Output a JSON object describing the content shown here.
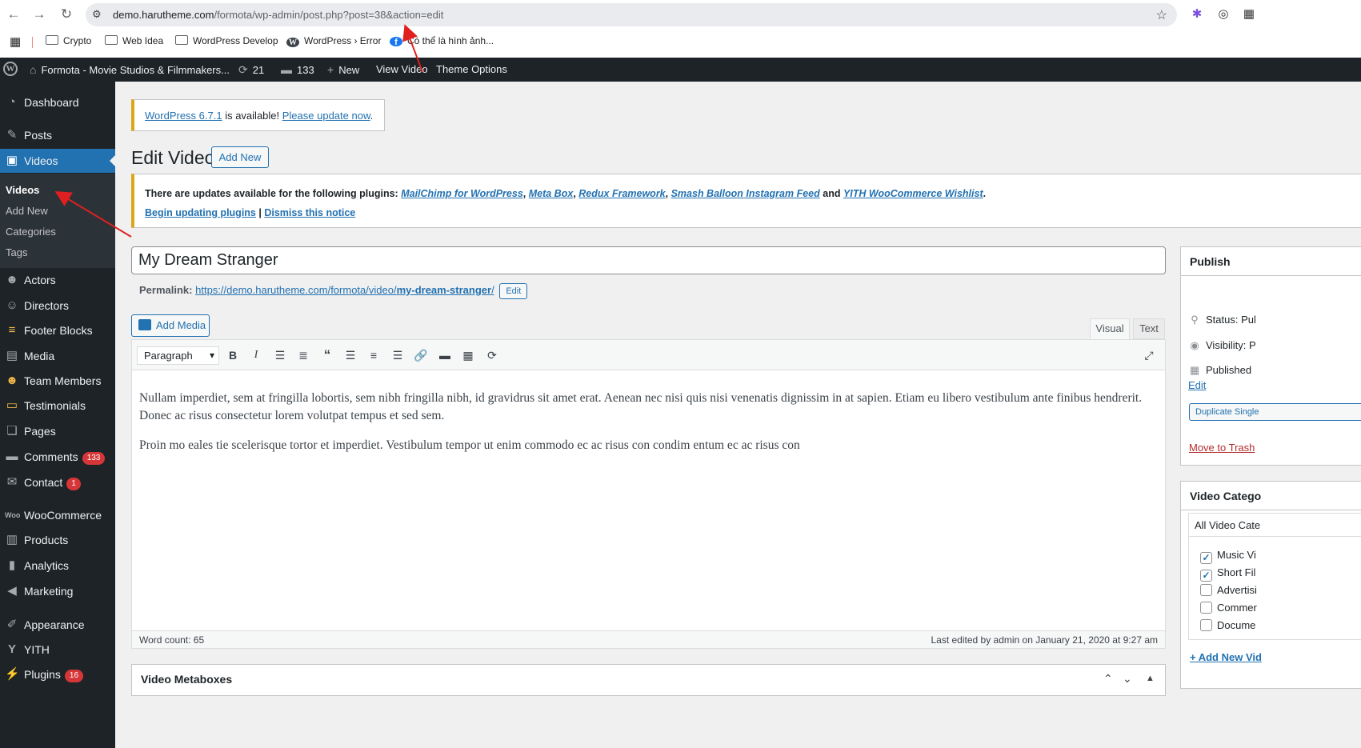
{
  "browser": {
    "url_host": "demo.harutheme.com",
    "url_path": "/formota/wp-admin/post.php?post=38&action=edit",
    "bookmarks": [
      {
        "label": "Crypto",
        "icon": "folder-icon"
      },
      {
        "label": "Web Idea",
        "icon": "folder-icon"
      },
      {
        "label": "WordPress Develop",
        "icon": "folder-icon"
      },
      {
        "label": "WordPress › Error",
        "icon": "wordpress-icon"
      },
      {
        "label": "Có thể là hình ảnh...",
        "icon": "facebook-icon"
      }
    ]
  },
  "adminbar": {
    "site_name": "Formota - Movie Studios & Filmmakers...",
    "updates_count": "21",
    "comments_count": "133",
    "new_label": "New",
    "view_label": "View Video",
    "theme_options_label": "Theme Options"
  },
  "sidebar": {
    "dashboard": "Dashboard",
    "posts": "Posts",
    "videos": "Videos",
    "sub": {
      "videos": "Videos",
      "add_new": "Add New",
      "categories": "Categories",
      "tags": "Tags"
    },
    "actors": "Actors",
    "directors": "Directors",
    "footer_blocks": "Footer Blocks",
    "media": "Media",
    "team_members": "Team Members",
    "testimonials": "Testimonials",
    "pages": "Pages",
    "comments": "Comments",
    "comments_badge": "133",
    "contact": "Contact",
    "contact_badge": "1",
    "woocommerce": "WooCommerce",
    "products": "Products",
    "analytics": "Analytics",
    "marketing": "Marketing",
    "appearance": "Appearance",
    "yith": "YITH",
    "plugins": "Plugins",
    "plugins_badge": "16"
  },
  "notice_update": {
    "link": "WordPress 6.7.1",
    "text": " is available! ",
    "action": "Please update now",
    "end": "."
  },
  "page": {
    "title": "Edit Video",
    "add_new": "Add New"
  },
  "notice_plugins": {
    "prefix": "There are updates available for the following plugins: ",
    "p1": "MailChimp for WordPress",
    "p2": "Meta Box",
    "p3": "Redux Framework",
    "p4": "Smash Balloon Instagram Feed",
    "and": " and ",
    "p5": "YITH WooCommerce Wishlist",
    "end": ".",
    "begin": "Begin updating plugins",
    "sep": " | ",
    "dismiss": "Dismiss this notice"
  },
  "post": {
    "title": "My Dream Stranger",
    "permalink_label": "Permalink:",
    "permalink_base": "https://demo.harutheme.com/formota/video/",
    "permalink_slug": "my-dream-stranger",
    "permalink_end": "/",
    "edit_label": "Edit"
  },
  "editor": {
    "add_media": "Add Media",
    "tab_visual": "Visual",
    "tab_text": "Text",
    "format": "Paragraph",
    "paragraph1": "Nullam imperdiet, sem at fringilla lobortis, sem nibh fringilla nibh, id gravidrus sit amet erat. Aenean nec nisi quis nisi venenatis dignissim in at sapien. Etiam eu libero vestibulum ante finibus hendrerit. Donec ac risus consectetur lorem volutpat tempus et sed sem.",
    "paragraph2": "Proin mo eales tie scelerisque tortor et imperdiet. Vestibulum tempor ut enim commodo ec ac risus con condim entum ec ac risus con",
    "word_count": "Word count: 65",
    "last_edited": "Last edited by admin on January 21, 2020 at 9:27 am"
  },
  "metabox": {
    "title": "Video Metaboxes"
  },
  "publish": {
    "title": "Publish",
    "status": "Status: Pul",
    "visibility": "Visibility: P",
    "published": "Published",
    "edit": "Edit",
    "duplicate": "Duplicate Single",
    "trash": "Move to Trash"
  },
  "categories": {
    "title": "Video Catego",
    "tab": "All Video Cate",
    "items": [
      {
        "label": "Music Vi",
        "checked": true
      },
      {
        "label": "Short Fil",
        "checked": true
      },
      {
        "label": "Advertisi",
        "checked": false
      },
      {
        "label": "Commer",
        "checked": false
      },
      {
        "label": "Docume",
        "checked": false
      }
    ],
    "add_new": "+ Add New Vid"
  }
}
